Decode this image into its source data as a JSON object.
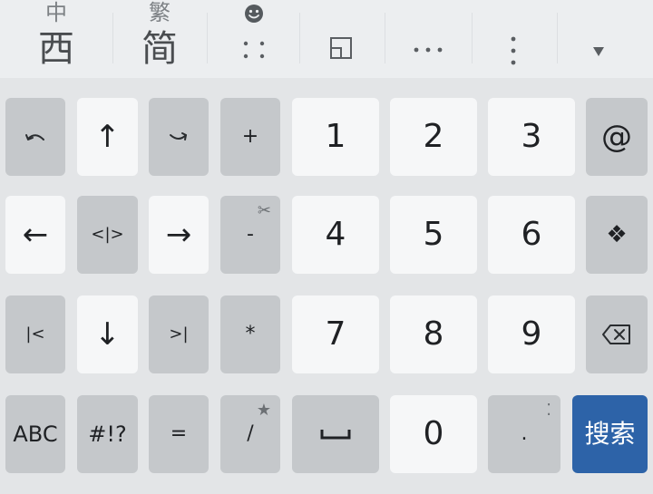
{
  "toolbar": {
    "zh_small": "中",
    "zh_big": "西",
    "trad_small": "繁",
    "trad_big": "简",
    "emoji_icon": "smiley-face-icon",
    "dots_icon": "⁚ ⁚",
    "window_icon": "floating-window-icon",
    "more_h": "···",
    "more_v": "⋮",
    "collapse": "▾"
  },
  "keys": {
    "undo": "⤺",
    "up": "↑",
    "redo": "⤻",
    "plus": "+",
    "k1": "1",
    "k2": "2",
    "k3": "3",
    "at": "@",
    "left": "←",
    "select": "<|>",
    "right": "→",
    "minus": "-",
    "minus_corner": "✂",
    "k4": "4",
    "k5": "5",
    "k6": "6",
    "move": "❖",
    "home": "|<",
    "down": "↓",
    "end": ">|",
    "star": "*",
    "k7": "7",
    "k8": "8",
    "k9": "9",
    "backspace": "⌫",
    "abc": "ABC",
    "symbols": "#!?",
    "equals": "=",
    "slash": "/",
    "slash_corner": "★",
    "space": "␣",
    "k0": "0",
    "dot": ".",
    "dot_corner": "⁚",
    "search": "搜索"
  },
  "colors": {
    "accent": "#2d63a8",
    "key_light": "#f6f7f8",
    "key_dark": "#c5c8cb",
    "background": "#e3e5e7"
  }
}
